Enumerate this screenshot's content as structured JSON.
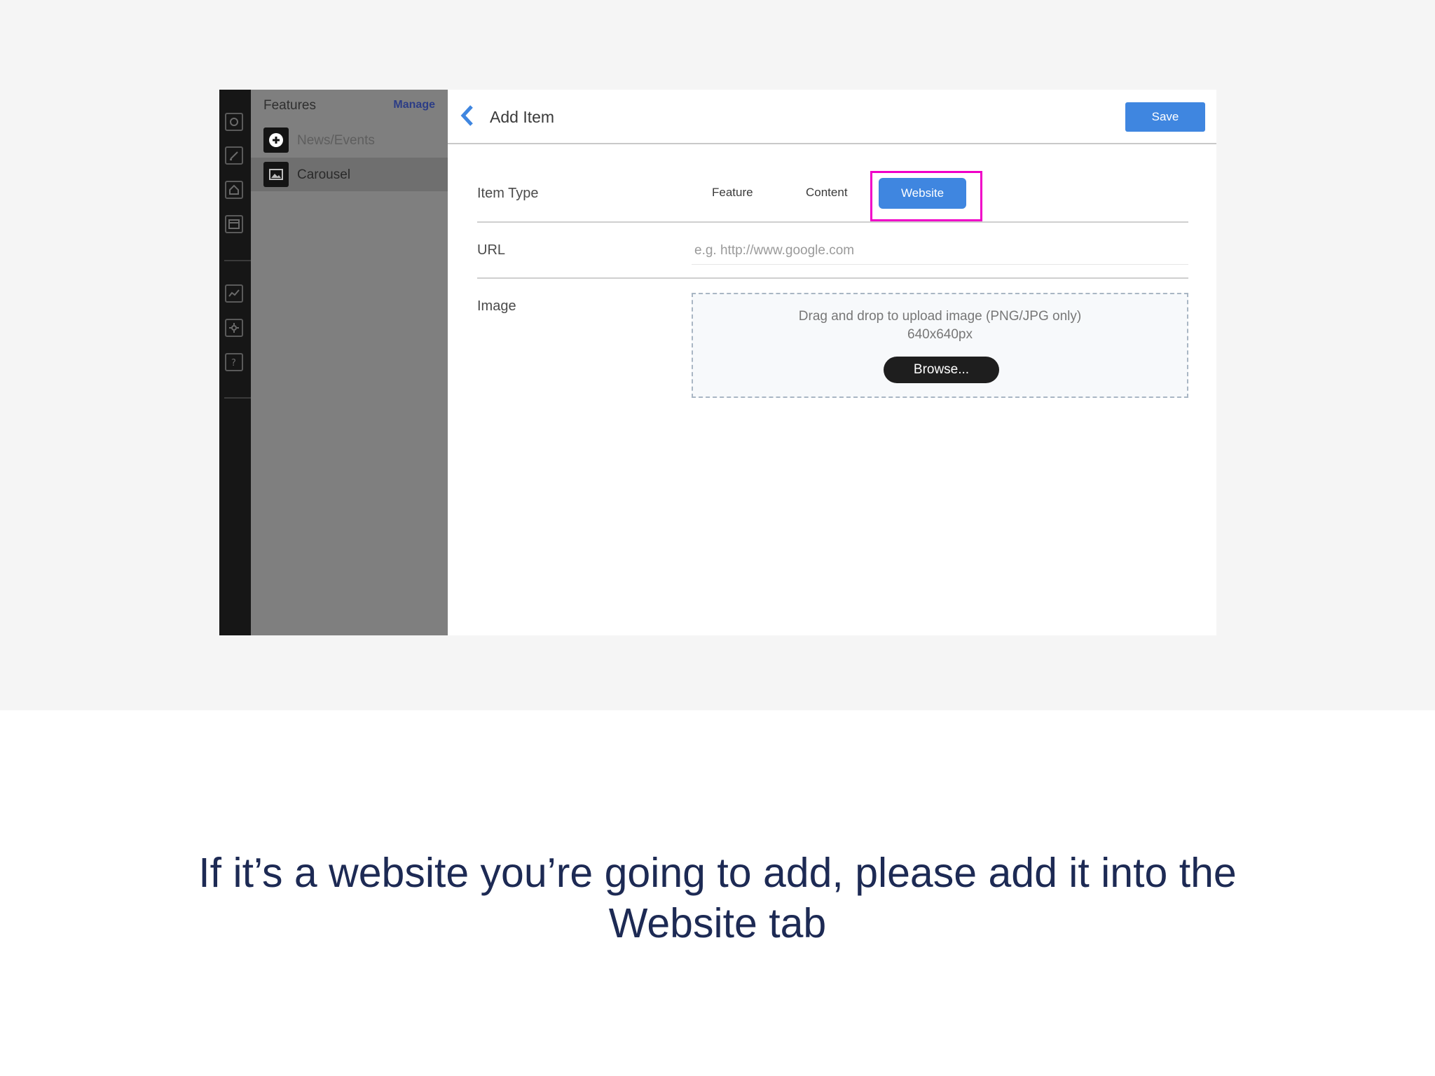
{
  "sidebar": {
    "title": "Features",
    "manage_label": "Manage",
    "items": [
      {
        "label": "News/Events",
        "icon": "plus-circle-icon"
      },
      {
        "label": "Carousel",
        "icon": "image-icon"
      }
    ]
  },
  "rail": {
    "icons": [
      "circle-square-icon",
      "edit-icon",
      "home-icon",
      "window-icon",
      "chart-icon",
      "settings-icon",
      "help-icon"
    ]
  },
  "header": {
    "title": "Add Item",
    "save_label": "Save"
  },
  "form": {
    "item_type_label": "Item Type",
    "types": [
      "Feature",
      "Content",
      "Website"
    ],
    "selected_type": "Website",
    "url_label": "URL",
    "url_placeholder": "e.g. http://www.google.com",
    "image_label": "Image",
    "dropzone_text": "Drag and drop to upload image (PNG/JPG only)",
    "dropzone_size": "640x640px",
    "browse_label": "Browse..."
  },
  "caption": {
    "line1": "If it’s a website you’re going to add, please add it into the",
    "line2": "Website tab"
  },
  "colors": {
    "accent": "#3f86e0",
    "highlight": "#f000c8",
    "caption": "#1d2a54"
  }
}
